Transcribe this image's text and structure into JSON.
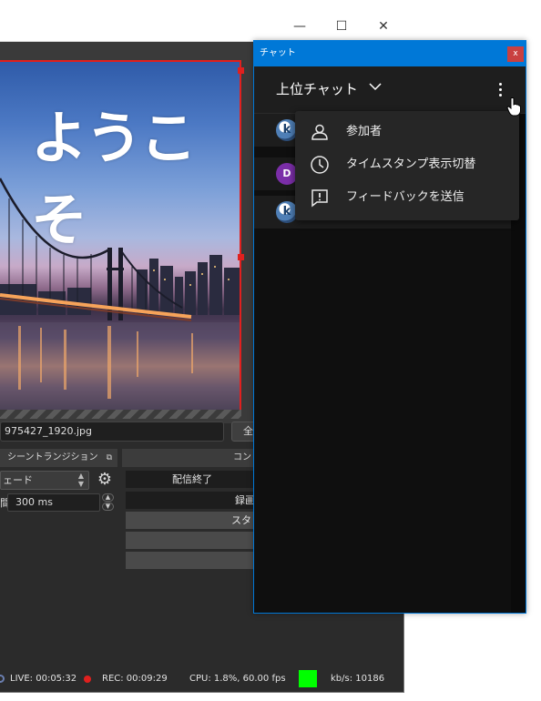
{
  "obs": {
    "window_controls": {
      "minimize": "—",
      "maximize": "☐",
      "close": "✕"
    },
    "preview": {
      "welcome_text": "ようこそ"
    },
    "source_name": "975427_1920.jpg",
    "props_button": "全",
    "scene_transitions": {
      "header": "シーントランジション",
      "transition_value": "ェード",
      "duration_label": "間",
      "duration_value": "300 ms"
    },
    "controls": {
      "header": "コント",
      "buttons": [
        "配信終了",
        "録画",
        "スタ",
        "",
        ""
      ]
    },
    "status": {
      "live": "LIVE: 00:05:32",
      "rec": "REC: 00:09:29",
      "cpu": "CPU: 1.8%, 60.00 fps",
      "kbps": "kb/s: 10186"
    },
    "colors": {
      "selection": "#e0201e",
      "health": "#00ff00",
      "accent": "#0078d7"
    }
  },
  "chat": {
    "window_title": "チャット",
    "close_label": "x",
    "mode_label": "上位チャット",
    "avatars": [
      "k",
      "D",
      "k"
    ],
    "menu": [
      {
        "icon": "person-icon",
        "label": "参加者"
      },
      {
        "icon": "clock-icon",
        "label": "タイムスタンプ表示切替"
      },
      {
        "icon": "feedback-icon",
        "label": "フィードバックを送信"
      }
    ]
  }
}
